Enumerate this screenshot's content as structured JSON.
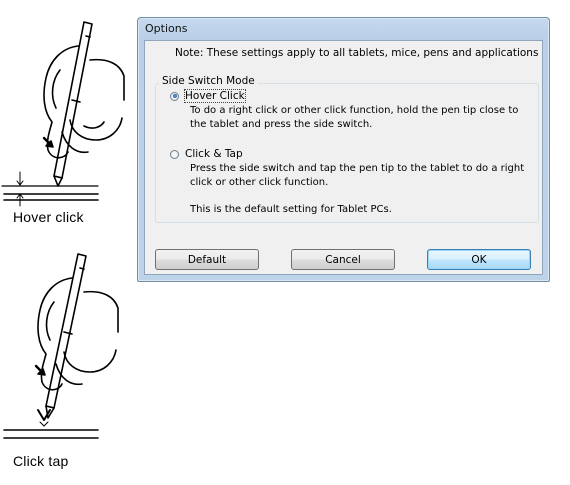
{
  "illustrations": {
    "hover": {
      "label": "Hover click",
      "icon": "pen-hover-icon"
    },
    "tap": {
      "label": "Click tap",
      "icon": "pen-tap-icon"
    }
  },
  "dialog": {
    "title": "Options",
    "note": "Note: These settings apply to all tablets, mice, pens and applications",
    "group_label": "Side Switch Mode",
    "options": [
      {
        "label": "Hover Click",
        "selected": true,
        "description": "To do a right click or other click function, hold the pen tip close to the tablet and press the side switch."
      },
      {
        "label": "Click & Tap",
        "selected": false,
        "description": "Press the side switch and tap the pen tip to the tablet to do a right click or other click function.",
        "extra": "This is the default setting for Tablet PCs."
      }
    ],
    "buttons": {
      "default": "Default",
      "cancel": "Cancel",
      "ok": "OK"
    }
  }
}
